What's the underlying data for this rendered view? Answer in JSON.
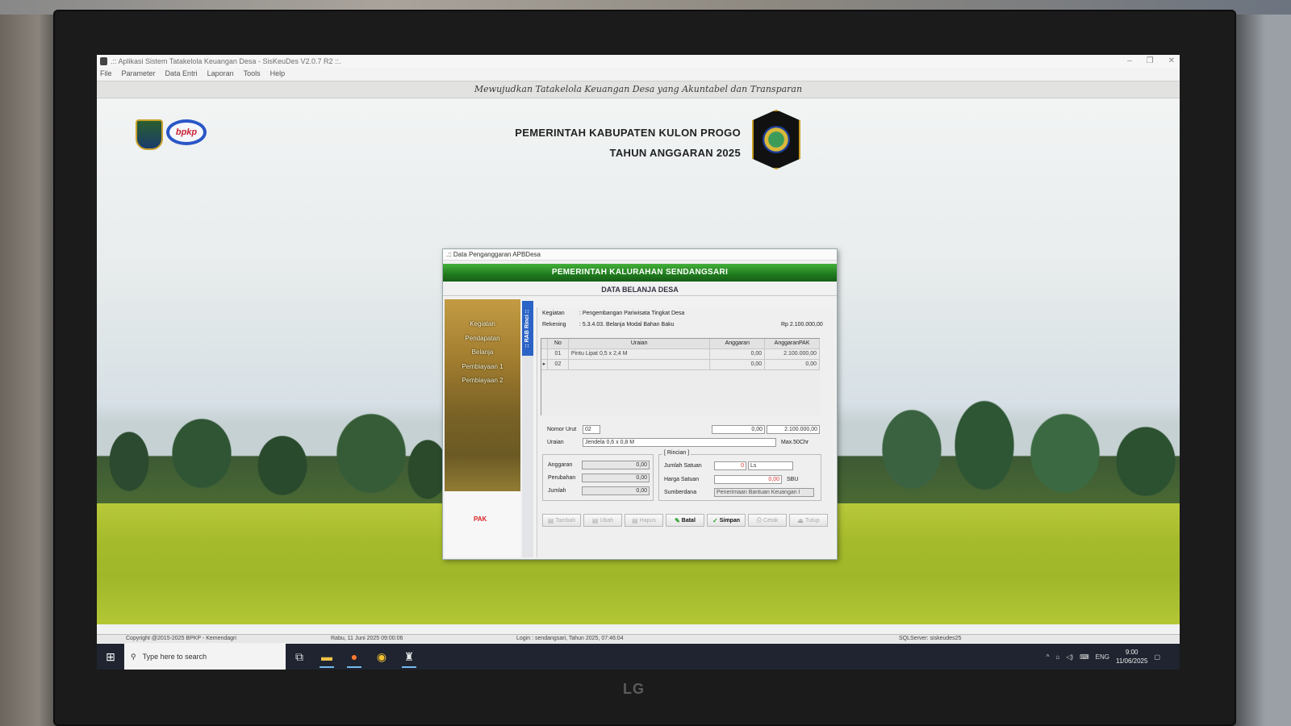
{
  "window": {
    "title": ".:: Aplikasi Sistem Tatakelola Keuangan Desa - SisKeuDes V2.0.7 R2 ::.",
    "controls": [
      "–",
      "❐",
      "✕"
    ]
  },
  "menu": [
    "File",
    "Parameter",
    "Data Entri",
    "Laporan",
    "Tools",
    "Help"
  ],
  "slogan": "Mewujudkan Tatakelola Keuangan Desa yang Akuntabel dan Transparan",
  "header": {
    "line1": "PEMERINTAH KABUPATEN KULON PROGO",
    "line2": "TAHUN ANGGARAN 2025",
    "bpkp_logo_text": "bpkp"
  },
  "dialog": {
    "title": ".:: Data Penganggaran APBDesa",
    "banner": "PEMERINTAH KALURAHAN SENDANGSARI",
    "subtitle": "DATA BELANJA DESA",
    "side_menu": [
      "Kegiatan",
      "Pendapatan",
      "Belanja",
      "Pembiayaan 1",
      "Pembiayaan 2"
    ],
    "side_footer": "PAK",
    "rab_tab": ":: RAB Rinci ::",
    "kegiatan_label": "Kegiatan",
    "kegiatan_value": ": Pengembangan Pariwisata Tingkat Desa",
    "rekening_label": "Rekening",
    "rekening_value": ": 5.3.4.03.  Belanja Modal Bahan Baku",
    "total": "Rp 2.100.000,00",
    "grid": {
      "columns": [
        "No",
        "Uraian",
        "Anggaran",
        "AnggaranPAK"
      ],
      "rows": [
        {
          "indicator": "",
          "no": "01",
          "uraian": "Pintu Lipat 0,5 x 2,4 M",
          "anggaran": "0,00",
          "pak": "2.100.000,00"
        },
        {
          "indicator": "▸",
          "no": "02",
          "uraian": "",
          "anggaran": "0,00",
          "pak": "0,00"
        }
      ]
    },
    "nomor_urut_label": "Nomor Urut",
    "nomor_urut_value": "02",
    "nomor_urut_ang": "0,00",
    "nomor_urut_pak": "2.100.000,00",
    "uraian_label": "Uraian",
    "uraian_value": "Jendela 0,6 x 0,8 M",
    "uraian_max": "Max.50Chr",
    "anggaran_label": "Anggaran",
    "anggaran_value": "0,00",
    "perubahan_label": "Perubahan",
    "perubahan_value": "0,00",
    "jumlah_label": "Jumlah",
    "jumlah_value": "0,00",
    "rincian_title": "[ Rincian ]",
    "jumlah_satuan_label": "Jumlah Satuan",
    "jumlah_satuan_value": "0",
    "satuan_value": "Ls",
    "harga_satuan_label": "Harga Satuan",
    "harga_satuan_value": "0,00",
    "sbu_label": "SBU",
    "sumberdana_label": "Sumberdana",
    "sumberdana_value": "Penerimaan Bantuan Keuangan I",
    "buttons": {
      "tambah": "Tambah",
      "ubah": "Ubah",
      "hapus": "Hapus",
      "batal": "Batal",
      "simpan": "Simpan",
      "cetak": "Cetak",
      "tutup": "Tutup"
    }
  },
  "status": {
    "copyright": "Copyright @2015-2025 BPKP - Kemendagri",
    "date": "Rabu, 11 Juni 2025  09:00:06",
    "login": "Login : sendangsari,  Tahun 2025, 07:46:04",
    "server": "SQLServer: siskeudes25"
  },
  "taskbar": {
    "search_placeholder": "Type here to search",
    "lang": "ENG",
    "time": "9:00",
    "date": "11/06/2025"
  },
  "monitor_brand": "LG"
}
